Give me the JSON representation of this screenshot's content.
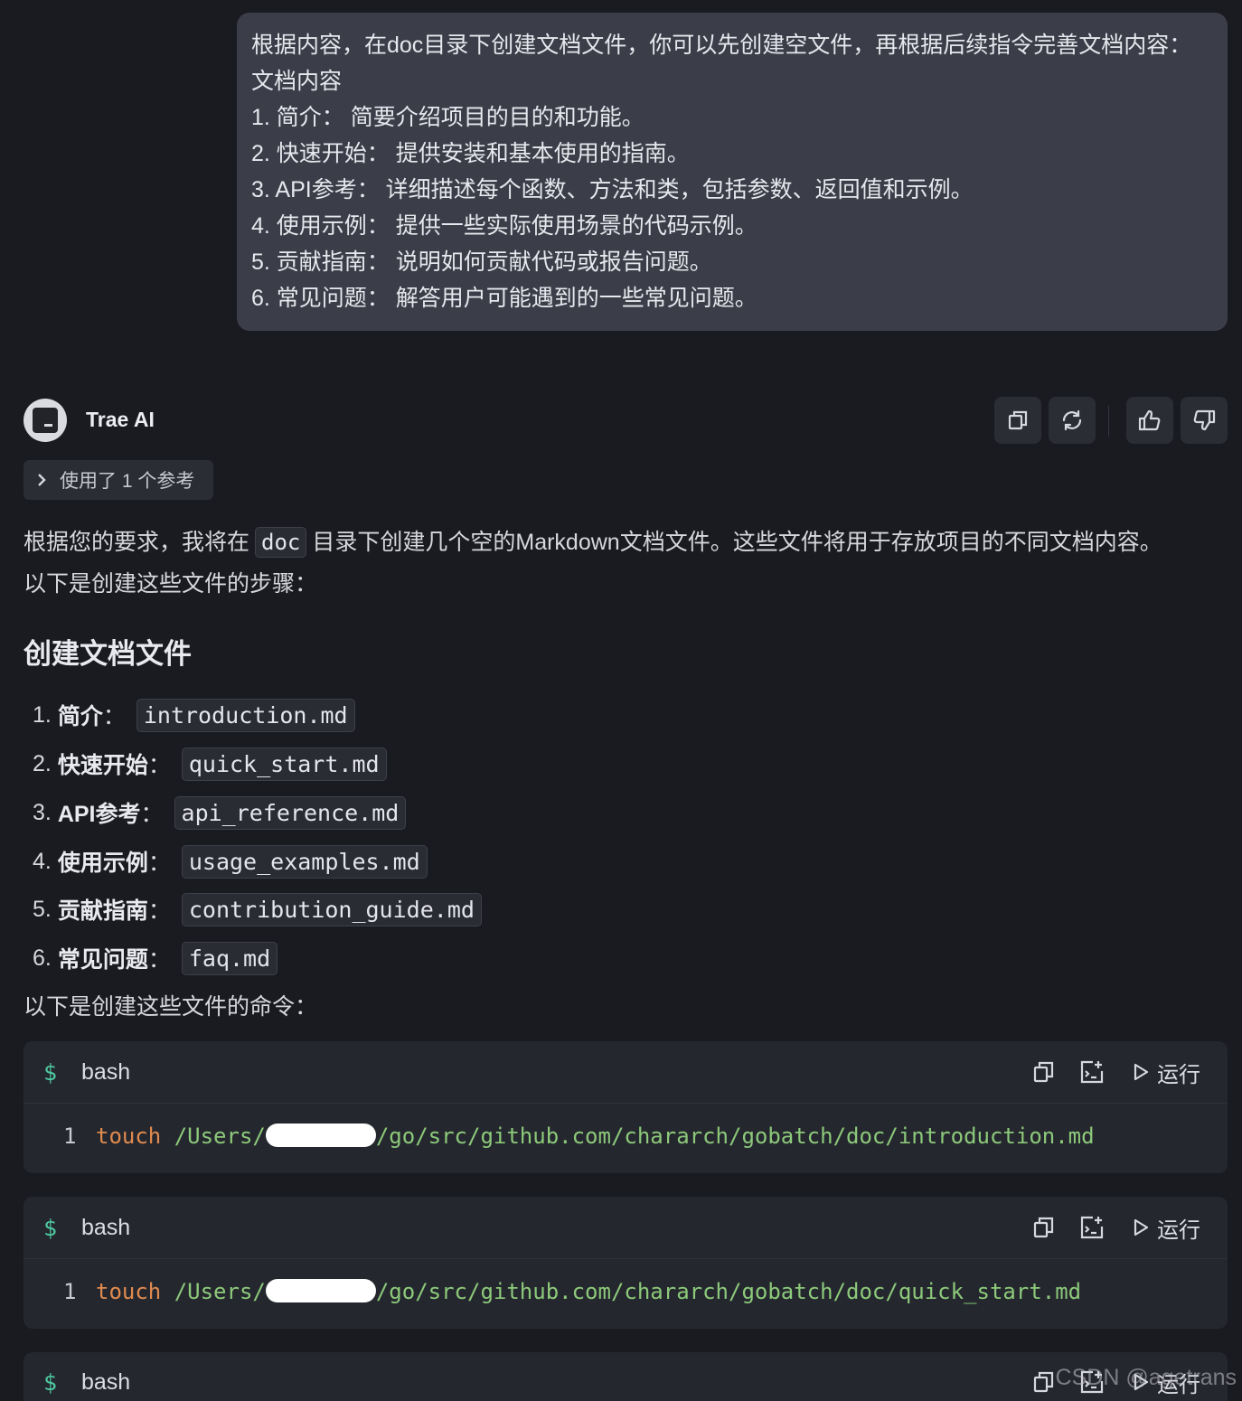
{
  "user_message": {
    "lines": [
      "根据内容，在doc目录下创建文档文件，你可以先创建空文件，再根据后续指令完善文档内容：",
      "文档内容",
      "1. 简介： 简要介绍项目的目的和功能。",
      "2. 快速开始： 提供安装和基本使用的指南。",
      "3. API参考： 详细描述每个函数、方法和类，包括参数、返回值和示例。",
      "4. 使用示例： 提供一些实际使用场景的代码示例。",
      "5. 贡献指南： 说明如何贡献代码或报告问题。",
      "6. 常见问题： 解答用户可能遇到的一些常见问题。"
    ]
  },
  "assistant": {
    "name": "Trae AI",
    "refs_label": "使用了 1 个参考",
    "intro_pre": "根据您的要求，我将在",
    "intro_code": "doc",
    "intro_post": "目录下创建几个空的Markdown文档文件。这些文件将用于存放项目的不同文档内容。",
    "intro_line2": "以下是创建这些文件的步骤：",
    "section_title": "创建文档文件",
    "items": [
      {
        "num": "1.",
        "label": "简介",
        "file": "introduction.md"
      },
      {
        "num": "2.",
        "label": "快速开始",
        "file": "quick_start.md"
      },
      {
        "num": "3.",
        "label": "API参考",
        "file": "api_reference.md"
      },
      {
        "num": "4.",
        "label": "使用示例",
        "file": "usage_examples.md"
      },
      {
        "num": "5.",
        "label": "贡献指南",
        "file": "contribution_guide.md"
      },
      {
        "num": "6.",
        "label": "常见问题",
        "file": "faq.md"
      }
    ],
    "commands_intro": "以下是创建这些文件的命令：",
    "code_blocks": [
      {
        "lang": "bash",
        "line_no": "1",
        "cmd": "touch",
        "path_pre": "/Users/",
        "path_post": "/go/src/github.com/chararch/gobatch/doc/introduction.md",
        "run_label": "运行"
      },
      {
        "lang": "bash",
        "line_no": "1",
        "cmd": "touch",
        "path_pre": "/Users/",
        "path_post": "/go/src/github.com/chararch/gobatch/doc/quick_start.md",
        "run_label": "运行"
      },
      {
        "lang": "bash",
        "run_label": "运行"
      }
    ]
  },
  "watermark": "CSDN @agetrans",
  "colors": {
    "background": "#1a1b20",
    "bubble": "#3b3d48",
    "keyword": "#e08b4f",
    "path": "#8cc97a",
    "dollar": "#4ec9a0"
  }
}
